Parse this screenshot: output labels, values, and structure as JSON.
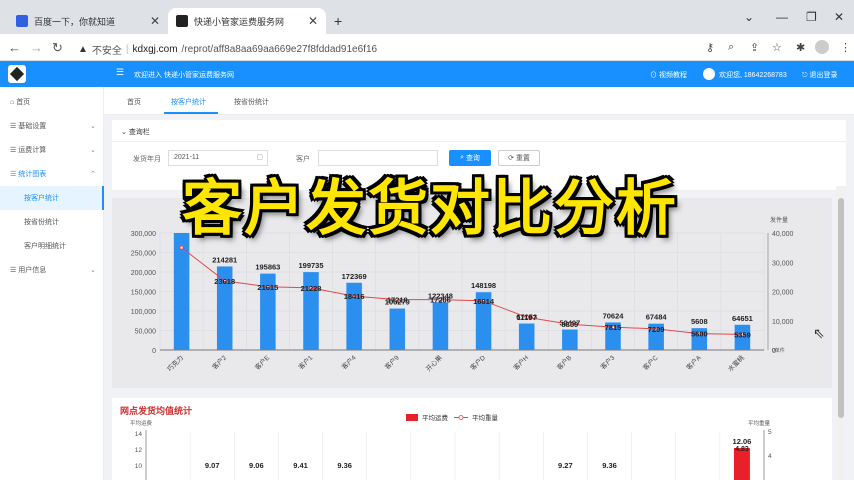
{
  "browser": {
    "tabs": [
      {
        "title": "百度一下，你就知道"
      },
      {
        "title": "快递小管家运费服务网"
      }
    ],
    "new_tab": "+",
    "url": {
      "insecure_label": "不安全",
      "host": "kdxgj.com",
      "path": "/reprot/aff8a8aa69aa669e27f8fddad91e6f16"
    }
  },
  "app": {
    "welcome": "欢迎进入 快递小管家运费服务网",
    "video_tutorial": "视频教程",
    "user_greeting": "欢迎您, 18642268783",
    "logout": "退出登录"
  },
  "sidebar": {
    "items": [
      {
        "label": "首页",
        "icon": "home-icon"
      },
      {
        "label": "基础设置",
        "icon": "settings-icon",
        "chevron": "⌄"
      },
      {
        "label": "运费计算",
        "icon": "calc-icon",
        "chevron": "⌄"
      },
      {
        "label": "统计图表",
        "icon": "chart-icon",
        "chevron": "⌃"
      },
      {
        "label": "按客户统计",
        "sub": true,
        "active": true
      },
      {
        "label": "按省份统计",
        "sub": true
      },
      {
        "label": "客户明细统计",
        "sub": true
      },
      {
        "label": "用户信息",
        "icon": "user-icon",
        "chevron": "⌄"
      }
    ]
  },
  "content_tabs": [
    {
      "label": "首页"
    },
    {
      "label": "按客户统计",
      "active": true
    },
    {
      "label": "按省份统计"
    }
  ],
  "query": {
    "title": "查询栏",
    "date_label": "发货年月",
    "date_value": "2021-11",
    "customer_label": "客户",
    "search_button": "查询",
    "reset_button": "重置"
  },
  "overlay_title": "客户发货对比分析",
  "chart_data": [
    {
      "type": "bar",
      "title": "",
      "right_axis_label": "发件量",
      "right_axis_unit": "0单件",
      "categories": [
        "巧克力",
        "客户2",
        "客户E",
        "客户1",
        "客户4",
        "客户9",
        "开心果",
        "客户D",
        "客户H",
        "客户B",
        "客户3",
        "客户C",
        "客户A",
        "水蜜桃"
      ],
      "series": [
        {
          "name": "",
          "kind": "bar",
          "values": [
            300000,
            214281,
            195863,
            199735,
            172369,
            106279,
            122348,
            148198,
            67853,
            52497,
            70624,
            67484,
            56000,
            64651
          ]
        },
        {
          "name": "",
          "kind": "line",
          "values": [
            35000,
            23618,
            21615,
            21228,
            18416,
            17219,
            17206,
            16814,
            11197,
            8809,
            7815,
            7209,
            5608,
            5359
          ]
        }
      ],
      "bar_labels": [
        "",
        "214281",
        "195863",
        "199735",
        "172369",
        "106279",
        "122348",
        "148198",
        "67853",
        "52497",
        "70624",
        "67484",
        "5608",
        "64651"
      ],
      "line_labels": [
        "",
        "23618",
        "21615",
        "21228",
        "18416",
        "17219",
        "17206",
        "16814",
        "11197",
        "8809",
        "7815",
        "7209",
        "5600",
        "5359"
      ],
      "ylim_left": [
        0,
        300000
      ],
      "left_ticks": [
        "0",
        "50,000",
        "100,000",
        "150,000",
        "200,000",
        "250,000",
        "300,000"
      ],
      "ylim_right": [
        0,
        40000
      ],
      "right_ticks": [
        "0",
        "10,000",
        "20,000",
        "30,000",
        "40,000"
      ]
    },
    {
      "type": "bar",
      "title": "网点发货均值统计",
      "left_axis_label": "平均运费",
      "right_axis_label": "平均重量",
      "legend": [
        "平均运费",
        "平均重量"
      ],
      "left_ticks": [
        "10",
        "12",
        "14"
      ],
      "right_ticks": [
        "4",
        "5"
      ],
      "visible_labels": [
        "9.07",
        "9.06",
        "9.41",
        "9.36",
        "9.27",
        "9.36",
        "12.06",
        "4.83"
      ]
    }
  ],
  "colors": {
    "accent": "#1890ff",
    "bar": "#2b8ff0",
    "line": "#e04a4a",
    "overlay": "#ffe600",
    "legend_red": "#e8202a"
  }
}
